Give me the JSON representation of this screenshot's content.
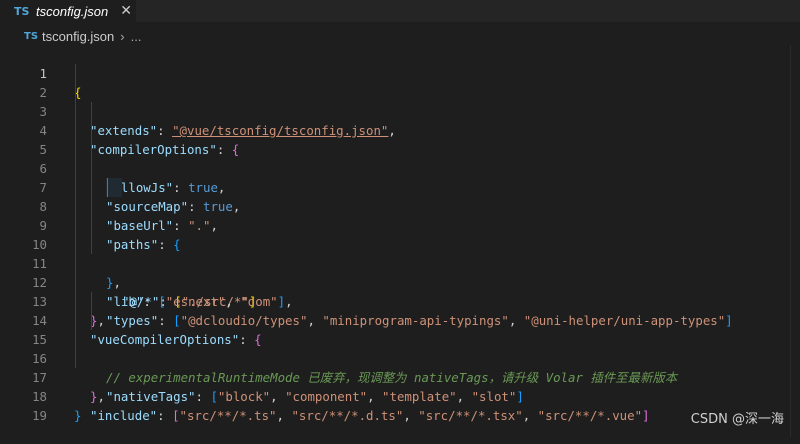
{
  "tab": {
    "icon_text": "TS",
    "title": "tsconfig.json",
    "close": "✕"
  },
  "breadcrumb": {
    "icon_text": "TS",
    "file": "tsconfig.json",
    "separator": "›",
    "more": "..."
  },
  "editor": {
    "line_numbers": [
      "1",
      "2",
      "3",
      "4",
      "5",
      "6",
      "7",
      "8",
      "9",
      "10",
      "11",
      "12",
      "13",
      "14",
      "15",
      "16",
      "17",
      "18",
      "19"
    ],
    "active_line": 1,
    "code": {
      "l1_brace": "{",
      "l2_key": "\"extends\"",
      "l2_colon": ": ",
      "l2_val": "\"@vue/tsconfig/tsconfig.json\"",
      "l2_comma": ",",
      "l3_key": "\"compilerOptions\"",
      "l3_colon": ": ",
      "l3_brace": "{",
      "l4_key": "\"allowJs\"",
      "l4_colon": ": ",
      "l4_val": "true",
      "l4_comma": ",",
      "l5_key": "\"sourceMap\"",
      "l5_colon": ": ",
      "l5_val": "true",
      "l5_comma": ",",
      "l6_key": "\"baseUrl\"",
      "l6_colon": ": ",
      "l6_val": "\".\"",
      "l6_comma": ",",
      "l7_key": "\"paths\"",
      "l7_colon": ": ",
      "l7_brace": "{",
      "l8_key": "\"@/*\"",
      "l8_colon": ": ",
      "l8_open": "[",
      "l8_val": "\"./src/*\"",
      "l8_close": "]",
      "l9_brace": "}",
      "l9_comma": ",",
      "l10_key": "\"lib\"",
      "l10_colon": ": ",
      "l10_open": "[",
      "l10_v1": "\"esnext\"",
      "l10_sep": ", ",
      "l10_v2": "\"dom\"",
      "l10_close": "]",
      "l10_comma": ",",
      "l11_key": "\"types\"",
      "l11_colon": ": ",
      "l11_open": "[",
      "l11_v1": "\"@dcloudio/types\"",
      "l11_sep1": ", ",
      "l11_v2": "\"miniprogram-api-typings\"",
      "l11_sep2": ", ",
      "l11_v3": "\"@uni-helper/uni-app-types\"",
      "l11_close": "]",
      "l12_brace": "}",
      "l12_comma": ",",
      "l13_key": "\"vueCompilerOptions\"",
      "l13_colon": ": ",
      "l13_brace": "{",
      "l14_comment": "// experimentalRuntimeMode 已废弃，现调整为 nativeTags，请升级 Volar 插件至最新版本",
      "l15_key": "\"nativeTags\"",
      "l15_colon": ": ",
      "l15_open": "[",
      "l15_v1": "\"block\"",
      "l15_sep1": ", ",
      "l15_v2": "\"component\"",
      "l15_sep2": ", ",
      "l15_v3": "\"template\"",
      "l15_sep3": ", ",
      "l15_v4": "\"slot\"",
      "l15_close": "]",
      "l16_brace": "}",
      "l16_comma": ",",
      "l17_key": "\"include\"",
      "l17_colon": ": ",
      "l17_open": "[",
      "l17_v1": "\"src/**/*.ts\"",
      "l17_sep1": ", ",
      "l17_v2": "\"src/**/*.d.ts\"",
      "l17_sep2": ", ",
      "l17_v3": "\"src/**/*.tsx\"",
      "l17_sep3": ", ",
      "l17_v4": "\"src/**/*.vue\"",
      "l17_close": "]",
      "l18_brace": "}"
    }
  },
  "watermark": "CSDN @深一海",
  "colors": {
    "background": "#1e1e1e",
    "key": "#9cdcfe",
    "string": "#ce9178",
    "keyword": "#569cd6",
    "comment": "#6a9955",
    "bracket_level1": "#ffd700",
    "bracket_level2": "#da70d6",
    "bracket_level3": "#179fff"
  }
}
